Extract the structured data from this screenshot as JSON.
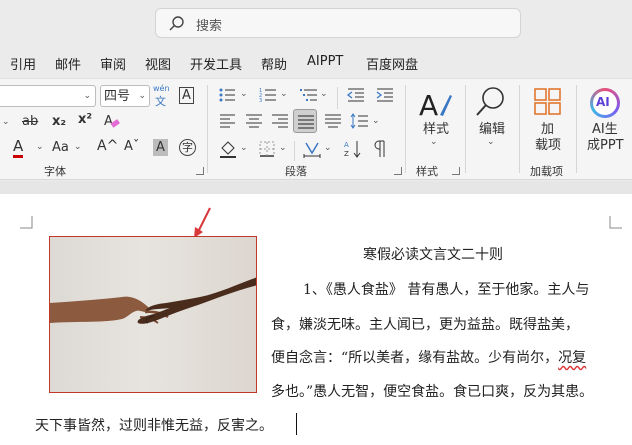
{
  "search": {
    "placeholder": "搜索"
  },
  "menu": {
    "tabs": [
      "引用",
      "邮件",
      "审阅",
      "视图",
      "开发工具",
      "帮助",
      "AIPPT",
      "百度网盘"
    ]
  },
  "ribbon": {
    "font_size": "四号",
    "wen_top": "wén",
    "wen_bottom": "文",
    "char_border": "A",
    "abc": "ab",
    "sub": "x₂",
    "sup": "x²",
    "a_color": "A",
    "aa": "Aa",
    "grow": "A^",
    "shrink": "Aˇ",
    "shade_a": "A",
    "enclose": "字",
    "styles_label": "样式",
    "edit_label": "编辑",
    "addin_top": "加",
    "addin_bottom": "载项",
    "ai_icon": "AI",
    "ai_top": "AI生",
    "ai_bottom": "成PPT",
    "groups": {
      "font": "字体",
      "paragraph": "段落",
      "styles": "样式",
      "addins": "加载项"
    }
  },
  "document": {
    "title": "寒假必读文言文二十则",
    "lines": [
      "1、《愚人食盐》 昔有愚人，至于他家。主人与",
      "食，嫌淡无味。主人闻已，更为益盐。既得盐美，",
      "多也。”愚人无智，便空食盐。食已口爽，反为其患。",
      "天下事皆然，过则非惟无益，反害之。"
    ],
    "line4_prefix": "便自念言：“所以美者，缘有盐故。少有尚尔，",
    "line4_underlined": "况复",
    "image_name": "hands-photo"
  },
  "colors": {
    "accent_red": "#c0392b",
    "ai_gradient": "#7b5cf0",
    "addin_orange": "#e0772e"
  }
}
